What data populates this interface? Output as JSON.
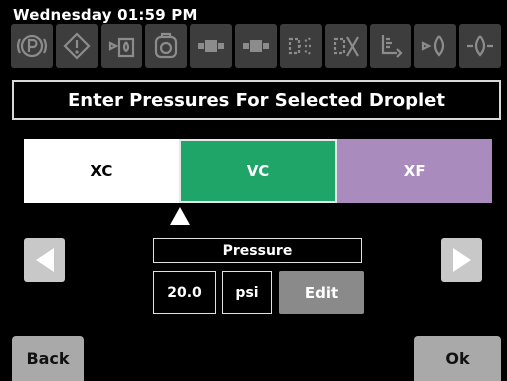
{
  "header": {
    "datetime": "Wednesday 01:59 PM"
  },
  "toolbar": {
    "icons": [
      "parking-icon",
      "warning-icon",
      "valve-droplet-icon",
      "pump-icon",
      "boom-icon",
      "boom-section-icon",
      "nozzle-spray-icon",
      "nozzle-off-icon",
      "tank-level-icon",
      "flow-droplet-icon",
      "droplet-sensor-icon"
    ]
  },
  "banner": {
    "title": "Enter Pressures For Selected Droplet"
  },
  "droplets": [
    {
      "label": "XC",
      "color": "#ffffff"
    },
    {
      "label": "VC",
      "color": "#1fa567",
      "selected": true
    },
    {
      "label": "XF",
      "color": "#a98cbd"
    }
  ],
  "pressure": {
    "label": "Pressure",
    "value": "20.0",
    "unit": "psi",
    "edit_label": "Edit"
  },
  "footer": {
    "back_label": "Back",
    "ok_label": "Ok"
  }
}
